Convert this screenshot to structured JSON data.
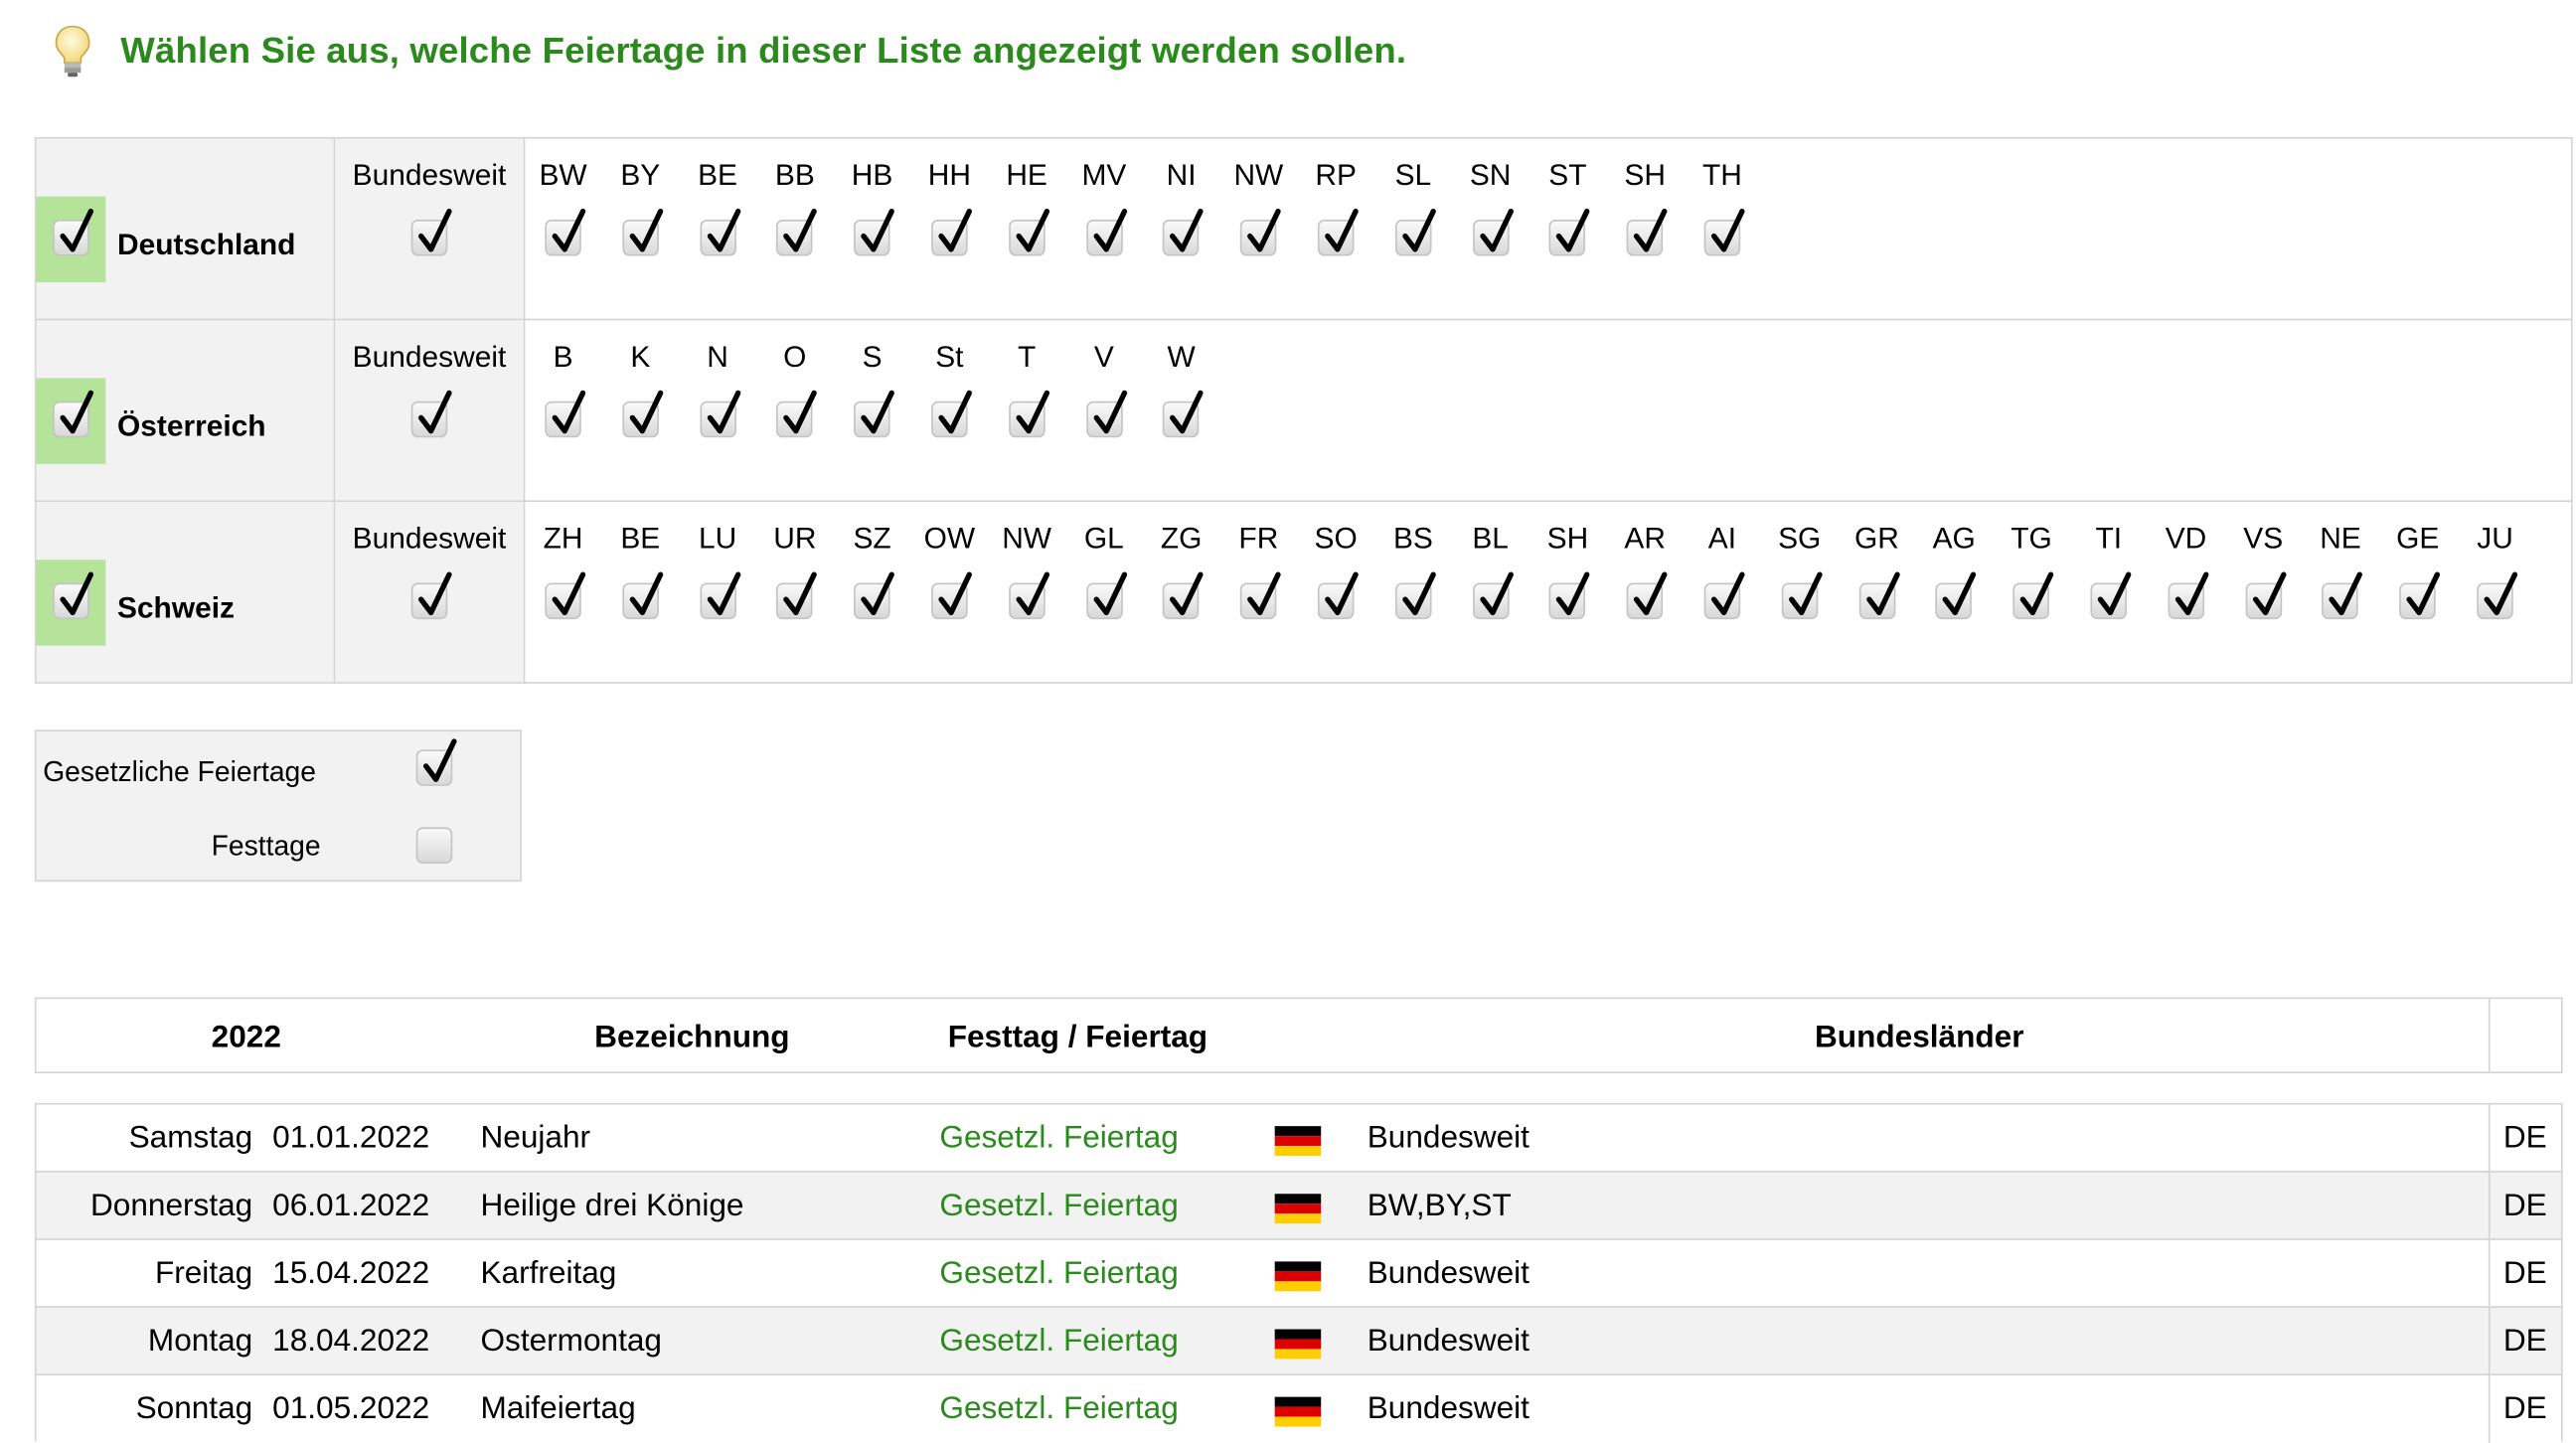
{
  "hint": {
    "icon": "lightbulb-icon",
    "text": "Wählen Sie aus, welche Feiertage in dieser Liste angezeigt werden sollen."
  },
  "filters": {
    "nationwide_label": "Bundesweit",
    "countries": [
      {
        "name": "Deutschland",
        "checked": true,
        "nationwide_checked": true,
        "regions": [
          "BW",
          "BY",
          "BE",
          "BB",
          "HB",
          "HH",
          "HE",
          "MV",
          "NI",
          "NW",
          "RP",
          "SL",
          "SN",
          "ST",
          "SH",
          "TH"
        ]
      },
      {
        "name": "Österreich",
        "checked": true,
        "nationwide_checked": true,
        "regions": [
          "B",
          "K",
          "N",
          "O",
          "S",
          "St",
          "T",
          "V",
          "W"
        ]
      },
      {
        "name": "Schweiz",
        "checked": true,
        "nationwide_checked": true,
        "regions": [
          "ZH",
          "BE",
          "LU",
          "UR",
          "SZ",
          "OW",
          "NW",
          "GL",
          "ZG",
          "FR",
          "SO",
          "BS",
          "BL",
          "SH",
          "AR",
          "AI",
          "SG",
          "GR",
          "AG",
          "TG",
          "TI",
          "VD",
          "VS",
          "NE",
          "GE",
          "JU"
        ]
      }
    ]
  },
  "types": [
    {
      "label": "Gesetzliche Feiertage",
      "checked": true
    },
    {
      "label": "Festtage",
      "checked": false
    }
  ],
  "table": {
    "headers": {
      "year": "2022",
      "name": "Bezeichnung",
      "type": "Festtag / Feiertag",
      "states": "Bundesländer"
    },
    "rows": [
      {
        "day": "Samstag",
        "date": "01.01.2022",
        "name": "Neujahr",
        "type": "Gesetzl. Feiertag",
        "flag": "germany-flag-icon",
        "states": "Bundesweit",
        "code": "DE"
      },
      {
        "day": "Donnerstag",
        "date": "06.01.2022",
        "name": "Heilige drei Könige",
        "type": "Gesetzl. Feiertag",
        "flag": "germany-flag-icon",
        "states": "BW,BY,ST",
        "code": "DE"
      },
      {
        "day": "Freitag",
        "date": "15.04.2022",
        "name": "Karfreitag",
        "type": "Gesetzl. Feiertag",
        "flag": "germany-flag-icon",
        "states": "Bundesweit",
        "code": "DE"
      },
      {
        "day": "Montag",
        "date": "18.04.2022",
        "name": "Ostermontag",
        "type": "Gesetzl. Feiertag",
        "flag": "germany-flag-icon",
        "states": "Bundesweit",
        "code": "DE"
      },
      {
        "day": "Sonntag",
        "date": "01.05.2022",
        "name": "Maifeiertag",
        "type": "Gesetzl. Feiertag",
        "flag": "germany-flag-icon",
        "states": "Bundesweit",
        "code": "DE"
      }
    ]
  },
  "colors": {
    "accent_green": "#2a8a1c",
    "country_highlight": "#b5e39a",
    "panel_gray": "#f2f2f2"
  }
}
